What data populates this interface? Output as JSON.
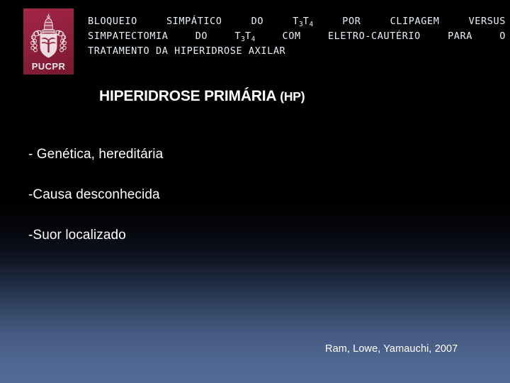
{
  "slide": {
    "background": {
      "top_color": "#000000",
      "bottom_color": "#516a97"
    },
    "logo": {
      "name": "PUCPR",
      "caption": "PUCPR",
      "background_color": "#8d1f39",
      "crest_color": "#f0dde2"
    },
    "title": {
      "line1": [
        "BLOQUEIO",
        "SIMPÁTICO",
        "DO",
        "T3T4",
        "POR",
        "CLIPAGEM",
        "VERSUS"
      ],
      "line2": [
        "SIMPATECTOMIA",
        "DO",
        "T3T4",
        "COM",
        "ELETRO-CAUTÉRIO",
        "PARA",
        "O"
      ],
      "line3": "TRATAMENTO DA HIPERIDROSE AXILAR",
      "full_text": "BLOQUEIO SIMPÁTICO DO T3T4 POR CLIPAGEM VERSUS SIMPATECTOMIA DO T3T4 COM ELETRO-CAUTÉRIO PARA O TRATAMENTO DA HIPERIDROSE AXILAR",
      "t3_base": "T",
      "t3_sub": "3",
      "t4_base": "T",
      "t4_sub": "4"
    },
    "heading": {
      "main": "HIPERIDROSE PRIMÁRIA ",
      "abbrev": "(HP)"
    },
    "bullets": [
      "- Genética, hereditária",
      "-Causa desconhecida",
      "-Suor localizado"
    ],
    "citation": "Ram, Lowe, Yamauchi, 2007"
  }
}
